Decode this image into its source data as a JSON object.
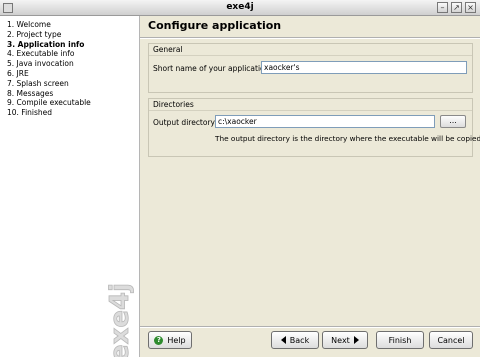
{
  "window": {
    "title": "exe4j"
  },
  "title_buttons": {
    "minimize": "–",
    "maximize": "↗",
    "close": "×"
  },
  "sidebar": {
    "steps": [
      "1. Welcome",
      "2. Project type",
      "3. Application info",
      "4. Executable info",
      "5. Java invocation",
      "6. JRE",
      "7. Splash screen",
      "8. Messages",
      "9. Compile executable",
      "10. Finished"
    ],
    "active_index": 2,
    "brand": "exe4j"
  },
  "page": {
    "heading": "Configure application"
  },
  "general": {
    "label": "General",
    "short_name_label": "Short name of your application:",
    "short_name_value": "xaocker's"
  },
  "directories": {
    "label": "Directories",
    "output_label": "Output directory:",
    "output_value": "c:\\xaocker",
    "browse_label": "...",
    "note": "The output directory is the directory where the executable will be copied."
  },
  "buttons": {
    "help": "Help",
    "back": "Back",
    "next": "Next",
    "finish": "Finish",
    "cancel": "Cancel"
  },
  "colors": {
    "help_icon": "#2e8b2e",
    "sidebar_bg": "#ffffff",
    "window_bg": "#ece9d8"
  }
}
